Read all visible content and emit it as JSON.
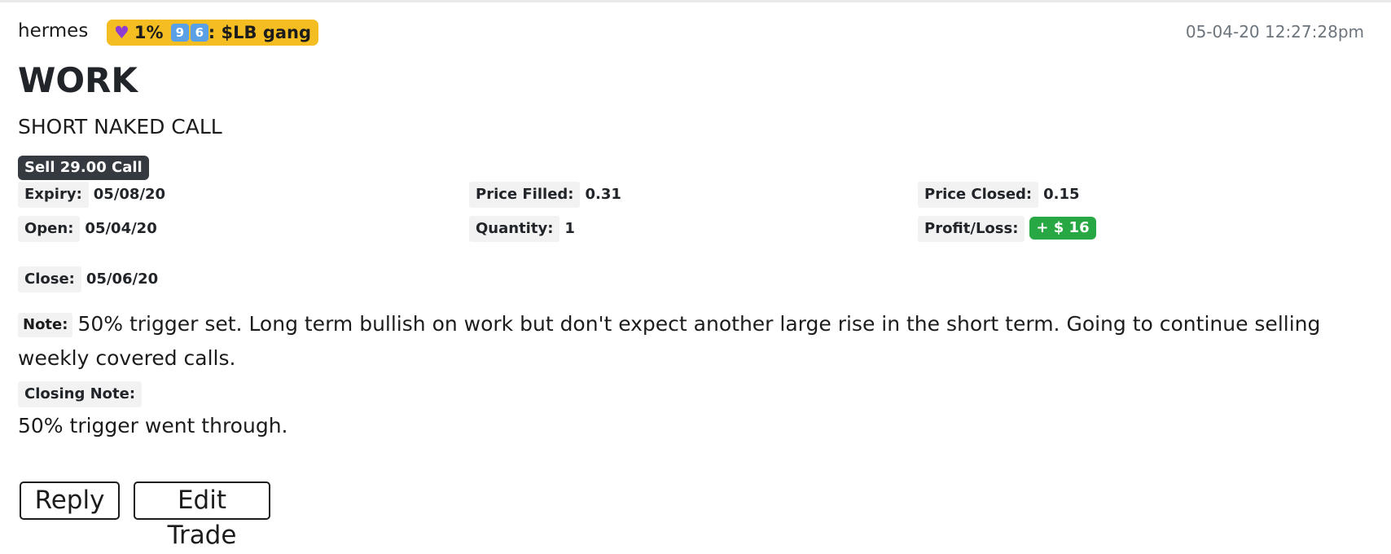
{
  "header": {
    "author": "hermes",
    "group_badge": {
      "icon": "purple-heart",
      "percent": "1%",
      "key_1": "9",
      "key_2": "6",
      "group_name": ": $LB gang",
      "color": "#f4bd22"
    },
    "timestamp": "05-04-20 12:27:28pm"
  },
  "trade": {
    "ticker": "WORK",
    "strategy": "SHORT NAKED CALL",
    "leg": "Sell 29.00 Call",
    "fields": {
      "expiry_label": "Expiry:",
      "expiry": "05/08/20",
      "open_label": "Open:",
      "open": "05/04/20",
      "close_label": "Close:",
      "close": "05/06/20",
      "price_filled_label": "Price Filled:",
      "price_filled": "0.31",
      "quantity_label": "Quantity:",
      "quantity": "1",
      "price_closed_label": "Price Closed:",
      "price_closed": "0.15",
      "profit_loss_label": "Profit/Loss:",
      "profit_loss": "+ $ 16",
      "profit_color": "#28a745"
    },
    "note_label": "Note:",
    "note": "50% trigger set. Long term bullish on work but don't expect another large rise in the short term. Going to continue selling weekly covered calls.",
    "closing_note_label": "Closing Note:",
    "closing_note": "50% trigger went through."
  },
  "actions": {
    "reply_label": "Reply",
    "edit_label": "Edit Trade"
  }
}
